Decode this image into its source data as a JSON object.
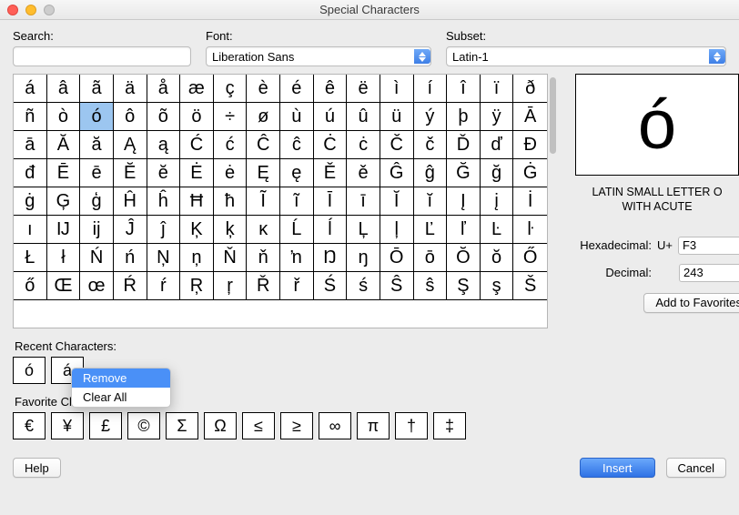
{
  "window": {
    "title": "Special Characters"
  },
  "top": {
    "search_label": "Search:",
    "search_value": "",
    "font_label": "Font:",
    "font_value": "Liberation Sans",
    "subset_label": "Subset:",
    "subset_value": "Latin-1"
  },
  "grid": {
    "selected_index": 18,
    "chars": [
      "á",
      "â",
      "ã",
      "ä",
      "å",
      "æ",
      "ç",
      "è",
      "é",
      "ê",
      "ë",
      "ì",
      "í",
      "î",
      "ï",
      "ð",
      "ñ",
      "ò",
      "ó",
      "ô",
      "õ",
      "ö",
      "÷",
      "ø",
      "ù",
      "ú",
      "û",
      "ü",
      "ý",
      "þ",
      "ÿ",
      "Ā",
      "ā",
      "Ă",
      "ă",
      "Ą",
      "ą",
      "Ć",
      "ć",
      "Ĉ",
      "ĉ",
      "Ċ",
      "ċ",
      "Č",
      "č",
      "Ď",
      "ď",
      "Đ",
      "đ",
      "Ē",
      "ē",
      "Ĕ",
      "ĕ",
      "Ė",
      "ė",
      "Ę",
      "ę",
      "Ě",
      "ě",
      "Ĝ",
      "ĝ",
      "Ğ",
      "ğ",
      "Ġ",
      "ġ",
      "Ģ",
      "ģ",
      "Ĥ",
      "ĥ",
      "Ħ",
      "ħ",
      "Ĩ",
      "ĩ",
      "Ī",
      "ī",
      "Ĭ",
      "ĭ",
      "Į",
      "į",
      "İ",
      "ı",
      "Ĳ",
      "ĳ",
      "Ĵ",
      "ĵ",
      "Ķ",
      "ķ",
      "ĸ",
      "Ĺ",
      "ĺ",
      "Ļ",
      "ļ",
      "Ľ",
      "ľ",
      "Ŀ",
      "ŀ",
      "Ł",
      "ł",
      "Ń",
      "ń",
      "Ņ",
      "ņ",
      "Ň",
      "ň",
      "ŉ",
      "Ŋ",
      "ŋ",
      "Ō",
      "ō",
      "Ŏ",
      "ŏ",
      "Ő",
      "ő",
      "Œ",
      "œ",
      "Ŕ",
      "ŕ",
      "Ŗ",
      "ŗ",
      "Ř",
      "ř",
      "Ś",
      "ś",
      "Ŝ",
      "ŝ",
      "Ş",
      "ş",
      "Š"
    ]
  },
  "preview": {
    "glyph": "ó",
    "name_line1": "LATIN SMALL LETTER O",
    "name_line2": "WITH ACUTE",
    "hex_label": "Hexadecimal:",
    "hex_prefix": "U+",
    "hex_value": "F3",
    "dec_label": "Decimal:",
    "dec_value": "243",
    "add_fav": "Add to Favorites"
  },
  "recent": {
    "label": "Recent Characters:",
    "chars": [
      "ó",
      "á"
    ]
  },
  "context_menu": {
    "remove": "Remove",
    "clear_all": "Clear All"
  },
  "favorites": {
    "label": "Favorite Characters:",
    "chars": [
      "€",
      "¥",
      "£",
      "©",
      "Σ",
      "Ω",
      "≤",
      "≥",
      "∞",
      "π",
      "†",
      "‡"
    ]
  },
  "buttons": {
    "help": "Help",
    "insert": "Insert",
    "cancel": "Cancel"
  }
}
